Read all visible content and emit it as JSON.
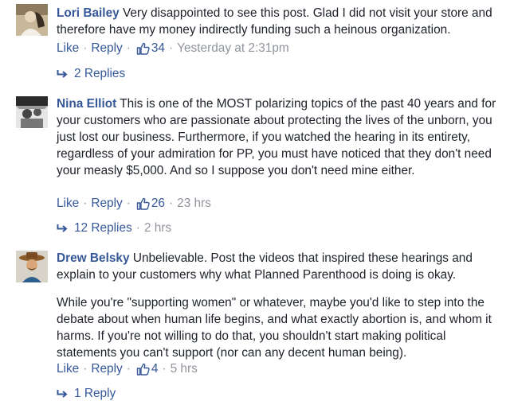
{
  "comments": [
    {
      "name": "Lori Bailey",
      "paragraphs": [
        "Very disappointed to see this post. Glad I did not visit your store and therefore have my money indirectly funding such a heinous organization."
      ],
      "actions": {
        "like": "Like",
        "reply": "Reply",
        "likes": "34",
        "time": "Yesterday at 2:31pm"
      },
      "replies": {
        "label": "2 Replies",
        "time": ""
      }
    },
    {
      "name": "Nina Elliot",
      "paragraphs": [
        "This is one of the MOST polarizing topics of the past 40 years and for your customers who are passionate about protecting the lives of the unborn, you just lost our business. Furthermore, if you watched the hearing in its entirety, regardless of your admiration for PP, you must have noticed that they don't need your measly $5,000. And so I suppose you don't need mine either."
      ],
      "actions": {
        "like": "Like",
        "reply": "Reply",
        "likes": "26",
        "time": "23 hrs"
      },
      "replies": {
        "label": "12 Replies",
        "time": "2 hrs"
      }
    },
    {
      "name": "Drew Belsky",
      "paragraphs": [
        "Unbelievable. Post the videos that inspired these hearings and explain to your customers why what Planned Parenthood is doing is okay.",
        "While you're \"supporting women\" or whatever, maybe you'd like to step into the debate about when human life begins, and what exactly abortion is, and whom it harms. If you're not willing to do that, you shouldn't start making political statements you can't support (nor can any decent human being)."
      ],
      "actions": {
        "like": "Like",
        "reply": "Reply",
        "likes": "4",
        "time": "5 hrs"
      },
      "replies": {
        "label": "1 Reply",
        "time": ""
      }
    }
  ],
  "separator": "·",
  "colors": {
    "link": "#365899",
    "meta": "#90949c",
    "text": "#1d2129"
  }
}
